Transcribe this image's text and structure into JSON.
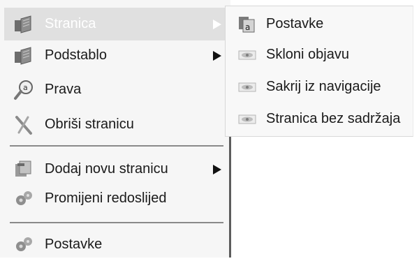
{
  "menu": {
    "items": [
      {
        "label": "Stranica",
        "icon": "pages-icon",
        "has_submenu": true,
        "active": true
      },
      {
        "label": "Podstablo",
        "icon": "pages-icon",
        "has_submenu": true
      },
      {
        "label": "Prava",
        "icon": "key-magnifier-icon",
        "has_submenu": false
      },
      {
        "label": "Obriši stranicu",
        "icon": "delete-x-icon",
        "has_submenu": false
      },
      {
        "label": "Dodaj novu stranicu",
        "icon": "new-page-icon",
        "has_submenu": true
      },
      {
        "label": "Promijeni redoslijed",
        "icon": "gears-icon",
        "has_submenu": false
      },
      {
        "label": "Postavke",
        "icon": "gears-icon",
        "has_submenu": false
      }
    ]
  },
  "submenu": {
    "items": [
      {
        "label": "Postavke",
        "icon": "page-settings-icon"
      },
      {
        "label": "Skloni objavu",
        "icon": "eye-icon"
      },
      {
        "label": "Sakrij iz navigacije",
        "icon": "eye-icon"
      },
      {
        "label": "Stranica bez sadržaja",
        "icon": "eye-icon"
      }
    ]
  },
  "colors": {
    "highlight": "#e0e0e0",
    "menu_bg": "#f6f6f6",
    "text": "#1a1a1a"
  }
}
